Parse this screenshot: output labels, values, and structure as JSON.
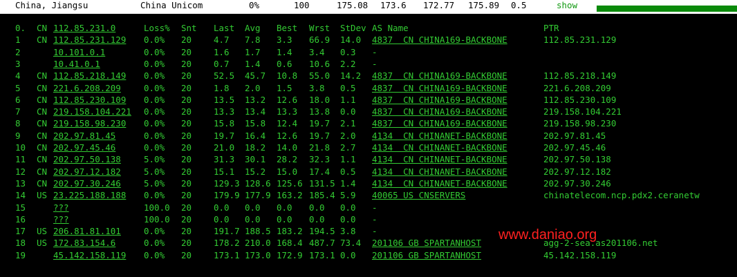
{
  "header": {
    "location": "China, Jiangsu",
    "isp": "China Unicom",
    "loss": "0%",
    "count": "100",
    "last": "175.08",
    "avg": "173.6",
    "best": "172.77",
    "worst": "175.89",
    "stdev": "0.5",
    "show_label": "show"
  },
  "columns": {
    "idx": "0.",
    "cc": "CN",
    "host": "112.85.231.0",
    "loss": "Loss%",
    "snt": "Snt",
    "last": "Last",
    "avg": "Avg",
    "best": "Best",
    "wrst": "Wrst",
    "stdev": "StDev",
    "as": "AS Name",
    "ptr": "PTR"
  },
  "rows": [
    {
      "idx": "1",
      "cc": "CN",
      "host": "112.85.231.129",
      "loss": "0.0%",
      "snt": "20",
      "last": "4.7",
      "avg": "7.8",
      "best": "3.3",
      "wrst": "66.9",
      "stdev": "14.0",
      "as": "4837  CN CHINA169-BACKBONE",
      "ptr": "112.85.231.129"
    },
    {
      "idx": "2",
      "cc": "",
      "host": "10.101.0.1",
      "loss": "0.0%",
      "snt": "20",
      "last": "1.6",
      "avg": "1.7",
      "best": "1.4",
      "wrst": "3.4",
      "stdev": "0.3",
      "as": "-",
      "ptr": ""
    },
    {
      "idx": "3",
      "cc": "",
      "host": "10.41.0.1",
      "loss": "0.0%",
      "snt": "20",
      "last": "0.7",
      "avg": "1.4",
      "best": "0.6",
      "wrst": "10.6",
      "stdev": "2.2",
      "as": "-",
      "ptr": ""
    },
    {
      "idx": "4",
      "cc": "CN",
      "host": "112.85.218.149",
      "loss": "0.0%",
      "snt": "20",
      "last": "52.5",
      "avg": "45.7",
      "best": "10.8",
      "wrst": "55.0",
      "stdev": "14.2",
      "as": "4837  CN CHINA169-BACKBONE",
      "ptr": "112.85.218.149"
    },
    {
      "idx": "5",
      "cc": "CN",
      "host": "221.6.208.209",
      "loss": "0.0%",
      "snt": "20",
      "last": "1.8",
      "avg": "2.0",
      "best": "1.5",
      "wrst": "3.8",
      "stdev": "0.5",
      "as": "4837  CN CHINA169-BACKBONE",
      "ptr": "221.6.208.209"
    },
    {
      "idx": "6",
      "cc": "CN",
      "host": "112.85.230.109",
      "loss": "0.0%",
      "snt": "20",
      "last": "13.5",
      "avg": "13.2",
      "best": "12.6",
      "wrst": "18.0",
      "stdev": "1.1",
      "as": "4837  CN CHINA169-BACKBONE",
      "ptr": "112.85.230.109"
    },
    {
      "idx": "7",
      "cc": "CN",
      "host": "219.158.104.221",
      "loss": "0.0%",
      "snt": "20",
      "last": "13.3",
      "avg": "13.4",
      "best": "13.3",
      "wrst": "13.8",
      "stdev": "0.0",
      "as": "4837  CN CHINA169-BACKBONE",
      "ptr": "219.158.104.221"
    },
    {
      "idx": "8",
      "cc": "CN",
      "host": "219.158.98.230",
      "loss": "0.0%",
      "snt": "20",
      "last": "15.8",
      "avg": "15.8",
      "best": "12.4",
      "wrst": "19.7",
      "stdev": "2.1",
      "as": "4837  CN CHINA169-BACKBONE",
      "ptr": "219.158.98.230"
    },
    {
      "idx": "9",
      "cc": "CN",
      "host": "202.97.81.45",
      "loss": "0.0%",
      "snt": "20",
      "last": "19.7",
      "avg": "16.4",
      "best": "12.6",
      "wrst": "19.7",
      "stdev": "2.0",
      "as": "4134  CN CHINANET-BACKBONE",
      "ptr": "202.97.81.45"
    },
    {
      "idx": "10",
      "cc": "CN",
      "host": "202.97.45.46",
      "loss": "0.0%",
      "snt": "20",
      "last": "21.0",
      "avg": "18.2",
      "best": "14.0",
      "wrst": "21.8",
      "stdev": "2.7",
      "as": "4134  CN CHINANET-BACKBONE",
      "ptr": "202.97.45.46"
    },
    {
      "idx": "11",
      "cc": "CN",
      "host": "202.97.50.138",
      "loss": "5.0%",
      "snt": "20",
      "last": "31.3",
      "avg": "30.1",
      "best": "28.2",
      "wrst": "32.3",
      "stdev": "1.1",
      "as": "4134  CN CHINANET-BACKBONE",
      "ptr": "202.97.50.138"
    },
    {
      "idx": "12",
      "cc": "CN",
      "host": "202.97.12.182",
      "loss": "5.0%",
      "snt": "20",
      "last": "15.1",
      "avg": "15.2",
      "best": "15.0",
      "wrst": "17.4",
      "stdev": "0.5",
      "as": "4134  CN CHINANET-BACKBONE",
      "ptr": "202.97.12.182"
    },
    {
      "idx": "13",
      "cc": "CN",
      "host": "202.97.30.246",
      "loss": "5.0%",
      "snt": "20",
      "last": "129.3",
      "avg": "128.6",
      "best": "125.6",
      "wrst": "131.5",
      "stdev": "1.4",
      "as": "4134  CN CHINANET-BACKBONE",
      "ptr": "202.97.30.246"
    },
    {
      "idx": "14",
      "cc": "US",
      "host": "23.225.188.188",
      "loss": "0.0%",
      "snt": "20",
      "last": "179.9",
      "avg": "177.9",
      "best": "163.2",
      "wrst": "185.4",
      "stdev": "5.9",
      "as": "40065 US CNSERVERS",
      "ptr": "chinatelecom.ncp.pdx2.ceranetw"
    },
    {
      "idx": "15",
      "cc": "",
      "host": "???",
      "loss": "100.0",
      "snt": "20",
      "last": "0.0",
      "avg": "0.0",
      "best": "0.0",
      "wrst": "0.0",
      "stdev": "0.0",
      "as": "-",
      "ptr": ""
    },
    {
      "idx": "16",
      "cc": "",
      "host": "???",
      "loss": "100.0",
      "snt": "20",
      "last": "0.0",
      "avg": "0.0",
      "best": "0.0",
      "wrst": "0.0",
      "stdev": "0.0",
      "as": "-",
      "ptr": ""
    },
    {
      "idx": "17",
      "cc": "US",
      "host": "206.81.81.101",
      "loss": "0.0%",
      "snt": "20",
      "last": "191.7",
      "avg": "188.5",
      "best": "183.2",
      "wrst": "194.5",
      "stdev": "3.8",
      "as": "-",
      "ptr": ""
    },
    {
      "idx": "18",
      "cc": "US",
      "host": "172.83.154.6",
      "loss": "0.0%",
      "snt": "20",
      "last": "178.2",
      "avg": "210.0",
      "best": "168.4",
      "wrst": "487.7",
      "stdev": "73.4",
      "as": "201106 GB SPARTANHOST",
      "ptr": "agg-2-sea.as201106.net"
    },
    {
      "idx": "19",
      "cc": "",
      "host": "45.142.158.119",
      "loss": "0.0%",
      "snt": "20",
      "last": "173.1",
      "avg": "173.0",
      "best": "172.9",
      "wrst": "173.1",
      "stdev": "0.0",
      "as": "201106 GB SPARTANHOST",
      "ptr": "45.142.158.119"
    }
  ],
  "watermark": "www.daniao.org",
  "colors": {
    "background": "#000000",
    "text": "#33cc33",
    "header_bg": "#ffffff",
    "header_text": "#000000",
    "progress_bar": "#0a8a0a",
    "watermark": "#ff2020"
  }
}
